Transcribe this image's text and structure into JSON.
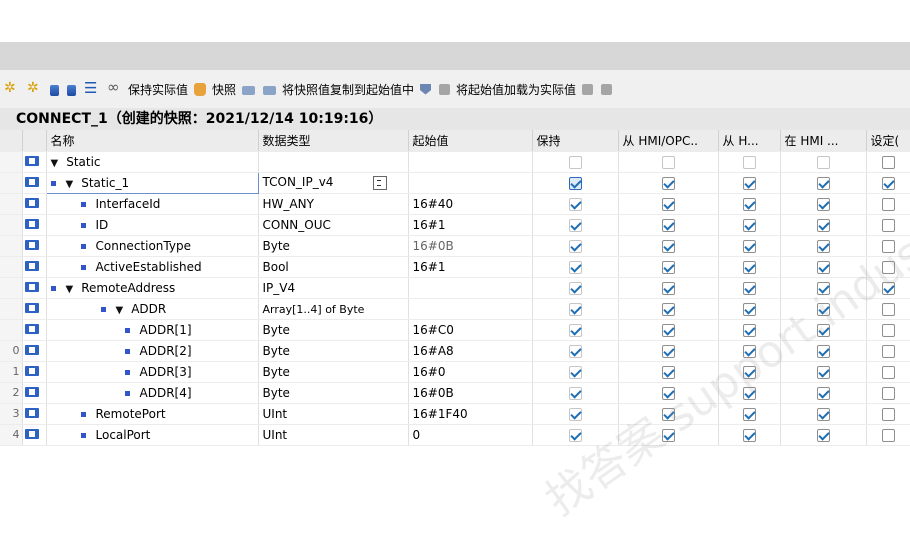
{
  "toolbar": {
    "keep_actual_label": "保持实际值",
    "snapshot_label": "快照",
    "copy_snapshot_label": "将快照值复制到起始值中",
    "load_start_label": "将起始值加载为实际值"
  },
  "tab_title": "CONNECT_1（创建的快照：2021/12/14 10:19:16）",
  "columns": {
    "name": "名称",
    "datatype": "数据类型",
    "start": "起始值",
    "retain": "保持",
    "hmi_opc": "从 HMI/OPC..",
    "from_h": "从 H...",
    "in_hmi": "在 HMI ...",
    "setpoint": "设定("
  },
  "rows": [
    {
      "num": "",
      "name": "Static",
      "type": "",
      "start": "",
      "level": 0
    },
    {
      "num": "",
      "name": "Static_1",
      "type": "TCON_IP_v4",
      "start": "",
      "level": 1
    },
    {
      "num": "",
      "name": "InterfaceId",
      "type": "HW_ANY",
      "start": "16#40",
      "level": 2
    },
    {
      "num": "",
      "name": "ID",
      "type": "CONN_OUC",
      "start": "16#1",
      "level": 2
    },
    {
      "num": "",
      "name": "ConnectionType",
      "type": "Byte",
      "start": "16#0B",
      "level": 2
    },
    {
      "num": "",
      "name": "ActiveEstablished",
      "type": "Bool",
      "start": "16#1",
      "level": 2
    },
    {
      "num": "",
      "name": "RemoteAddress",
      "type": "IP_V4",
      "start": "",
      "level": 2
    },
    {
      "num": "",
      "name": "ADDR",
      "type": "Array[1..4] of Byte",
      "start": "",
      "level": 3
    },
    {
      "num": "",
      "name": "ADDR[1]",
      "type": "Byte",
      "start": "16#C0",
      "level": 4
    },
    {
      "num": "0",
      "name": "ADDR[2]",
      "type": "Byte",
      "start": "16#A8",
      "level": 4
    },
    {
      "num": "1",
      "name": "ADDR[3]",
      "type": "Byte",
      "start": "16#0",
      "level": 4
    },
    {
      "num": "2",
      "name": "ADDR[4]",
      "type": "Byte",
      "start": "16#0B",
      "level": 4
    },
    {
      "num": "3",
      "name": "RemotePort",
      "type": "UInt",
      "start": "16#1F40",
      "level": 2
    },
    {
      "num": "4",
      "name": "LocalPort",
      "type": "UInt",
      "start": "0",
      "level": 2
    }
  ],
  "watermark": "找答案 support.industry.siemens.com/cs"
}
